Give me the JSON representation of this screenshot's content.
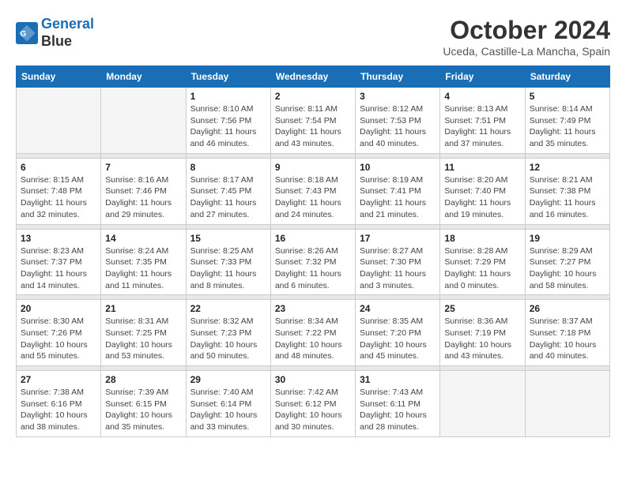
{
  "header": {
    "logo_line1": "General",
    "logo_line2": "Blue",
    "month_title": "October 2024",
    "location": "Uceda, Castille-La Mancha, Spain"
  },
  "weekdays": [
    "Sunday",
    "Monday",
    "Tuesday",
    "Wednesday",
    "Thursday",
    "Friday",
    "Saturday"
  ],
  "weeks": [
    [
      {
        "day": "",
        "empty": true
      },
      {
        "day": "",
        "empty": true
      },
      {
        "day": "1",
        "sunrise": "8:10 AM",
        "sunset": "7:56 PM",
        "daylight": "11 hours and 46 minutes."
      },
      {
        "day": "2",
        "sunrise": "8:11 AM",
        "sunset": "7:54 PM",
        "daylight": "11 hours and 43 minutes."
      },
      {
        "day": "3",
        "sunrise": "8:12 AM",
        "sunset": "7:53 PM",
        "daylight": "11 hours and 40 minutes."
      },
      {
        "day": "4",
        "sunrise": "8:13 AM",
        "sunset": "7:51 PM",
        "daylight": "11 hours and 37 minutes."
      },
      {
        "day": "5",
        "sunrise": "8:14 AM",
        "sunset": "7:49 PM",
        "daylight": "11 hours and 35 minutes."
      }
    ],
    [
      {
        "day": "6",
        "sunrise": "8:15 AM",
        "sunset": "7:48 PM",
        "daylight": "11 hours and 32 minutes."
      },
      {
        "day": "7",
        "sunrise": "8:16 AM",
        "sunset": "7:46 PM",
        "daylight": "11 hours and 29 minutes."
      },
      {
        "day": "8",
        "sunrise": "8:17 AM",
        "sunset": "7:45 PM",
        "daylight": "11 hours and 27 minutes."
      },
      {
        "day": "9",
        "sunrise": "8:18 AM",
        "sunset": "7:43 PM",
        "daylight": "11 hours and 24 minutes."
      },
      {
        "day": "10",
        "sunrise": "8:19 AM",
        "sunset": "7:41 PM",
        "daylight": "11 hours and 21 minutes."
      },
      {
        "day": "11",
        "sunrise": "8:20 AM",
        "sunset": "7:40 PM",
        "daylight": "11 hours and 19 minutes."
      },
      {
        "day": "12",
        "sunrise": "8:21 AM",
        "sunset": "7:38 PM",
        "daylight": "11 hours and 16 minutes."
      }
    ],
    [
      {
        "day": "13",
        "sunrise": "8:23 AM",
        "sunset": "7:37 PM",
        "daylight": "11 hours and 14 minutes."
      },
      {
        "day": "14",
        "sunrise": "8:24 AM",
        "sunset": "7:35 PM",
        "daylight": "11 hours and 11 minutes."
      },
      {
        "day": "15",
        "sunrise": "8:25 AM",
        "sunset": "7:33 PM",
        "daylight": "11 hours and 8 minutes."
      },
      {
        "day": "16",
        "sunrise": "8:26 AM",
        "sunset": "7:32 PM",
        "daylight": "11 hours and 6 minutes."
      },
      {
        "day": "17",
        "sunrise": "8:27 AM",
        "sunset": "7:30 PM",
        "daylight": "11 hours and 3 minutes."
      },
      {
        "day": "18",
        "sunrise": "8:28 AM",
        "sunset": "7:29 PM",
        "daylight": "11 hours and 0 minutes."
      },
      {
        "day": "19",
        "sunrise": "8:29 AM",
        "sunset": "7:27 PM",
        "daylight": "10 hours and 58 minutes."
      }
    ],
    [
      {
        "day": "20",
        "sunrise": "8:30 AM",
        "sunset": "7:26 PM",
        "daylight": "10 hours and 55 minutes."
      },
      {
        "day": "21",
        "sunrise": "8:31 AM",
        "sunset": "7:25 PM",
        "daylight": "10 hours and 53 minutes."
      },
      {
        "day": "22",
        "sunrise": "8:32 AM",
        "sunset": "7:23 PM",
        "daylight": "10 hours and 50 minutes."
      },
      {
        "day": "23",
        "sunrise": "8:34 AM",
        "sunset": "7:22 PM",
        "daylight": "10 hours and 48 minutes."
      },
      {
        "day": "24",
        "sunrise": "8:35 AM",
        "sunset": "7:20 PM",
        "daylight": "10 hours and 45 minutes."
      },
      {
        "day": "25",
        "sunrise": "8:36 AM",
        "sunset": "7:19 PM",
        "daylight": "10 hours and 43 minutes."
      },
      {
        "day": "26",
        "sunrise": "8:37 AM",
        "sunset": "7:18 PM",
        "daylight": "10 hours and 40 minutes."
      }
    ],
    [
      {
        "day": "27",
        "sunrise": "7:38 AM",
        "sunset": "6:16 PM",
        "daylight": "10 hours and 38 minutes."
      },
      {
        "day": "28",
        "sunrise": "7:39 AM",
        "sunset": "6:15 PM",
        "daylight": "10 hours and 35 minutes."
      },
      {
        "day": "29",
        "sunrise": "7:40 AM",
        "sunset": "6:14 PM",
        "daylight": "10 hours and 33 minutes."
      },
      {
        "day": "30",
        "sunrise": "7:42 AM",
        "sunset": "6:12 PM",
        "daylight": "10 hours and 30 minutes."
      },
      {
        "day": "31",
        "sunrise": "7:43 AM",
        "sunset": "6:11 PM",
        "daylight": "10 hours and 28 minutes."
      },
      {
        "day": "",
        "empty": true
      },
      {
        "day": "",
        "empty": true
      }
    ]
  ]
}
